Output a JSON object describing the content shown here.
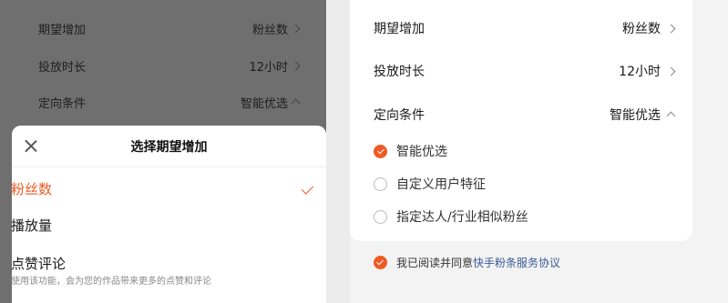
{
  "colors": {
    "accent": "#ee5a24",
    "link": "#3a5b9a",
    "overlay": "#6f6f6f"
  },
  "background_settings": [
    {
      "label": "期望增加",
      "value": "粉丝数",
      "icon": "chevron-right-icon"
    },
    {
      "label": "投放时长",
      "value": "12小时",
      "icon": "chevron-right-icon"
    },
    {
      "label": "定向条件",
      "value": "智能优选",
      "icon": "chevron-up-icon"
    }
  ],
  "sheet": {
    "title": "选择期望增加",
    "close_icon": "close-icon",
    "options": [
      {
        "label": "粉丝数",
        "selected": true
      },
      {
        "label": "播放量",
        "selected": false
      },
      {
        "label": "点赞评论",
        "selected": false,
        "subtitle": "使用该功能，会为您的作品带来更多的点赞和评论"
      }
    ]
  },
  "settings": [
    {
      "label": "期望增加",
      "value": "粉丝数",
      "icon": "chevron-right-icon"
    },
    {
      "label": "投放时长",
      "value": "12小时",
      "icon": "chevron-right-icon"
    },
    {
      "label": "定向条件",
      "value": "智能优选",
      "icon": "chevron-up-icon"
    }
  ],
  "targeting_options": [
    {
      "label": "智能优选",
      "selected": true
    },
    {
      "label": "自定义用户特征",
      "selected": false
    },
    {
      "label": "指定达人/行业相似粉丝",
      "selected": false
    }
  ],
  "agreement": {
    "prefix": "我已阅读并同意",
    "link": "快手粉条服务协议",
    "checked": true
  }
}
